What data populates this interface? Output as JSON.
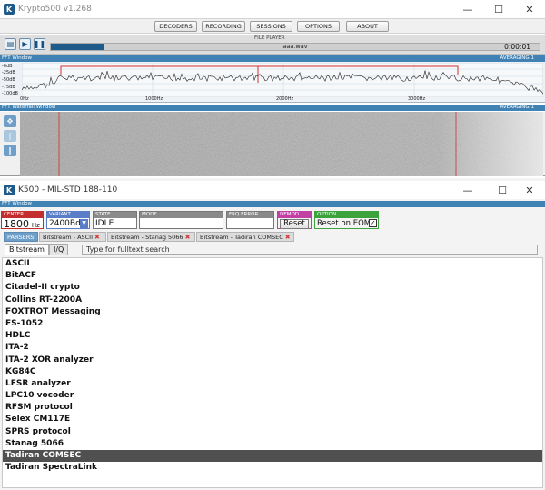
{
  "main_window": {
    "title": "Krypto500 v1.268",
    "menu": [
      "DECODERS",
      "RECORDING",
      "SESSIONS",
      "OPTIONS",
      "ABOUT"
    ],
    "file_player": {
      "label": "FILE PLAYER",
      "file": "aaa.wav",
      "time": "0:00:01",
      "progress": 0.11
    },
    "fft": {
      "header": "FFT Window",
      "averaging": "AVERAGING:1",
      "db_labels": [
        "-0dB",
        "-25dB",
        "-50dB",
        "-75dB",
        "-100dB"
      ],
      "hz_labels": [
        "0Hz",
        "1000Hz",
        "2000Hz",
        "3000Hz"
      ]
    },
    "waterfall": {
      "header": "FFT Waterfall Window",
      "averaging": "AVERAGING:1"
    }
  },
  "decoder_window": {
    "title": "K500 - MIL-STD 188-110",
    "fft_header": "FFT Window",
    "center": {
      "label": "CENTER",
      "value": "1800",
      "unit": "Hz"
    },
    "variant": {
      "label": "VARIANT",
      "value": "2400Bd"
    },
    "state": {
      "label": "STATE",
      "value": "IDLE"
    },
    "mode": {
      "label": "MODE",
      "value": ""
    },
    "frq_error": {
      "label": "FRQ.ERROR",
      "value": ""
    },
    "demod": {
      "label": "DEMOD",
      "button": "Reset"
    },
    "option": {
      "label": "OPTION",
      "button": "Reset on EOM",
      "checked": "✓"
    },
    "parser_tabs": [
      "PARSERS",
      "Bitstream - ASCII",
      "Bitstream - Stanag 5066",
      "Bitstream - Tadiran COMSEC"
    ],
    "sub_tabs": [
      "Bitstream",
      "I/Q"
    ],
    "search_placeholder": "Type for fulltext search",
    "parsers": [
      "ASCII",
      "BitACF",
      "Citadel-II crypto",
      "Collins RT-2200A",
      "FOXTROT Messaging",
      "FS-1052",
      "HDLC",
      "ITA-2",
      "ITA-2 XOR analyzer",
      "KG84C",
      "LFSR analyzer",
      "LPC10 vocoder",
      "RFSM protocol",
      "Selex CM117E",
      "SPRS protocol",
      "Stanag 5066",
      "Tadiran COMSEC",
      "Tadiran SpectraLink"
    ],
    "selected_parser": "Tadiran COMSEC"
  },
  "colors": {
    "accent": "#3f82b3",
    "center": "#c42d2d",
    "variant": "#5a7dc8",
    "demod": "#c23fa4",
    "option": "#3ca33c"
  }
}
